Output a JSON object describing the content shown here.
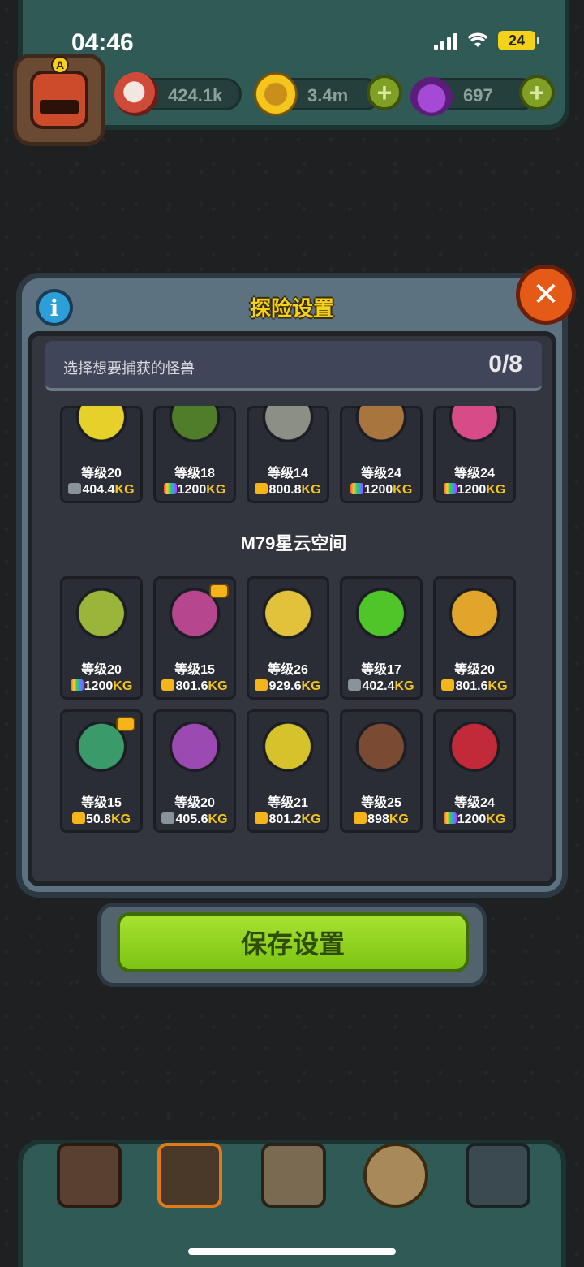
{
  "status_bar": {
    "time": "04:46",
    "battery": "24"
  },
  "resources": {
    "eyeballs": "424.1k",
    "coins": "3.4m",
    "potions": "697"
  },
  "dialog": {
    "title": "探险设置",
    "prompt": "选择想要捕获的怪兽",
    "selected_count": "0/8",
    "save_label": "保存设置"
  },
  "monsters_top_row": [
    {
      "level": "等级20",
      "weight_num": "404.4",
      "weight_unit": "KG",
      "weight_icon": "gray",
      "color": "#e6d02a"
    },
    {
      "level": "等级18",
      "weight_num": "1200",
      "weight_unit": "KG",
      "weight_icon": "rainbow",
      "color": "#4f7d2a"
    },
    {
      "level": "等级14",
      "weight_num": "800.8",
      "weight_unit": "KG",
      "weight_icon": "gold",
      "color": "#8b8f86"
    },
    {
      "level": "等级24",
      "weight_num": "1200",
      "weight_unit": "KG",
      "weight_icon": "rainbow",
      "color": "#a8753e"
    },
    {
      "level": "等级24",
      "weight_num": "1200",
      "weight_unit": "KG",
      "weight_icon": "rainbow",
      "color": "#d64b88"
    }
  ],
  "section": {
    "title": "M79星云空间"
  },
  "monsters_row1": [
    {
      "level": "等级20",
      "weight_num": "1200",
      "weight_unit": "KG",
      "weight_icon": "rainbow",
      "color": "#9bb43a",
      "badge": false
    },
    {
      "level": "等级15",
      "weight_num": "801.6",
      "weight_unit": "KG",
      "weight_icon": "gold",
      "color": "#b6478e",
      "badge": true
    },
    {
      "level": "等级26",
      "weight_num": "929.6",
      "weight_unit": "KG",
      "weight_icon": "gold",
      "color": "#e2c23a",
      "badge": false
    },
    {
      "level": "等级17",
      "weight_num": "402.4",
      "weight_unit": "KG",
      "weight_icon": "gray",
      "color": "#4fc52a",
      "badge": false
    },
    {
      "level": "等级20",
      "weight_num": "801.6",
      "weight_unit": "KG",
      "weight_icon": "gold",
      "color": "#e0a52a",
      "badge": false
    }
  ],
  "monsters_row2": [
    {
      "level": "等级15",
      "weight_num": "50.8",
      "weight_unit": "KG",
      "weight_icon": "gold",
      "color": "#3a9a6a",
      "badge": true
    },
    {
      "level": "等级20",
      "weight_num": "405.6",
      "weight_unit": "KG",
      "weight_icon": "gray",
      "color": "#9a4ab0",
      "badge": false
    },
    {
      "level": "等级21",
      "weight_num": "801.2",
      "weight_unit": "KG",
      "weight_icon": "gold",
      "color": "#d6c22a",
      "badge": false
    },
    {
      "level": "等级25",
      "weight_num": "898",
      "weight_unit": "KG",
      "weight_icon": "gold",
      "color": "#7a4a32",
      "badge": false
    },
    {
      "level": "等级24",
      "weight_num": "1200",
      "weight_unit": "KG",
      "weight_icon": "rainbow",
      "color": "#c22a3a",
      "badge": false
    }
  ],
  "bottom_nav": [
    {
      "icon": "shop-icon"
    },
    {
      "icon": "monster-lab-icon"
    },
    {
      "icon": "book-icon"
    },
    {
      "icon": "money-bag-icon"
    },
    {
      "icon": "grid-menu-icon"
    }
  ]
}
